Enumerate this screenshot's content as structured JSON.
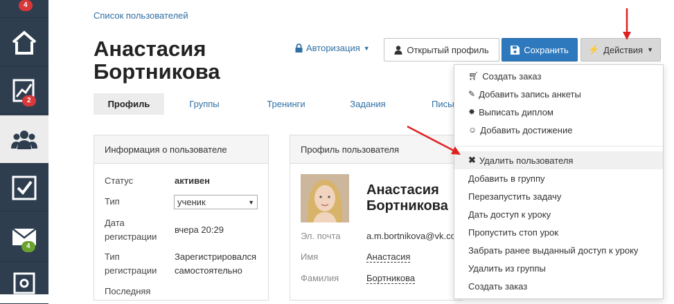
{
  "sidebar": {
    "items": [
      {
        "icon": "badge-only",
        "badge": "4"
      },
      {
        "icon": "home-icon"
      },
      {
        "icon": "chart-icon",
        "badge": "2"
      },
      {
        "icon": "users-icon",
        "active": true
      },
      {
        "icon": "checkbox-icon"
      },
      {
        "icon": "mail-icon",
        "badge": "4"
      },
      {
        "icon": "settings-icon"
      }
    ]
  },
  "breadcrumb": "Список пользователей",
  "page_title": "Анастасия Бортникова",
  "header": {
    "auth_label": "Авторизация",
    "open_profile_label": "Открытый профиль",
    "save_label": "Сохранить",
    "actions_label": "Действия"
  },
  "tabs": [
    "Профиль",
    "Группы",
    "Тренинги",
    "Задания",
    "Письма"
  ],
  "info_panel": {
    "title": "Информация о пользователе",
    "status_label": "Статус",
    "status_value": "активен",
    "type_label": "Тип",
    "type_value": "ученик",
    "reg_date_label_1": "Дата",
    "reg_date_label_2": "регистрации",
    "reg_date_value": "вчера 20:29",
    "reg_type_label_1": "Тип",
    "reg_type_label_2": "регистрации",
    "reg_type_value_1": "Зарегистрировался",
    "reg_type_value_2": "самостоятельно",
    "last_label": "Последняя"
  },
  "profile_panel": {
    "title": "Профиль пользователя",
    "first_name": "Анастасия",
    "last_name": "Бортникова",
    "email_label": "Эл. почта",
    "email_value": "a.m.bortnikova@vk.com",
    "name_label": "Имя",
    "name_value": "Анастасия",
    "surname_label": "Фамилия",
    "surname_value": "Бортникова"
  },
  "dropdown": {
    "items": [
      {
        "label": "Создать заказ",
        "icon": "cart-icon"
      },
      {
        "label": "Добавить запись анкеты",
        "icon": "pencil-icon"
      },
      {
        "label": "Выписать диплом",
        "icon": "certificate-icon"
      },
      {
        "label": "Добавить достижение",
        "icon": "smile-icon"
      },
      {
        "label": "Удалить пользователя",
        "icon": "times-icon"
      },
      {
        "label": "Добавить в группу"
      },
      {
        "label": "Перезапустить задачу"
      },
      {
        "label": "Дать доступ к уроку"
      },
      {
        "label": "Пропустить стоп урок"
      },
      {
        "label": "Забрать ранее выданный доступ к уроку"
      },
      {
        "label": "Удалить из группы"
      },
      {
        "label": "Создать заказ"
      }
    ]
  },
  "colors": {
    "sidebar_bg": "#2e3e4f",
    "primary": "#2e79be",
    "link": "#2f6fa4",
    "badge_red": "#d9383a",
    "badge_green": "#6aa22f",
    "annotation_arrow": "#e02020"
  }
}
